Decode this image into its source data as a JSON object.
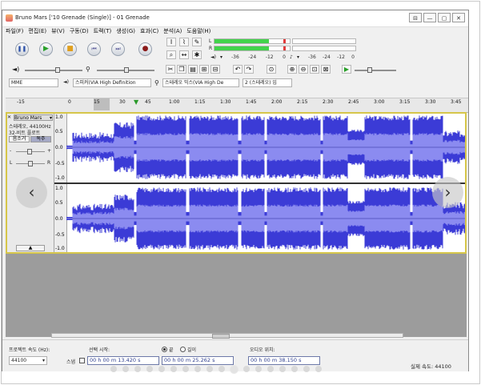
{
  "window": {
    "title": "Bruno Mars ['10 Grenade (Single)] - 01 Grenade",
    "buttons": [
      "⊟",
      "—",
      "▢",
      "✕"
    ]
  },
  "menu": [
    "파일(F)",
    "편집(E)",
    "뷰(V)",
    "구동(D)",
    "트랙(T)",
    "생성(G)",
    "효과(C)",
    "분석(A)",
    "도움말(H)"
  ],
  "transport": {
    "pause": "❚❚",
    "play": "▶",
    "stop": "■",
    "skip_start": "⏮",
    "skip_end": "⏭",
    "record": "●"
  },
  "meters": {
    "left_label": "L",
    "right_label": "R",
    "scale": [
      "-36",
      "-24",
      "-12",
      "0"
    ],
    "rec_scale": [
      "-36",
      "-24",
      "-12",
      "0"
    ],
    "left_level": 0.72,
    "right_level": 0.72,
    "colors": {
      "level": "#42d34b",
      "clip": "#e03c3c"
    }
  },
  "device": {
    "host": "MME",
    "output": "스피커(VIA High Definition",
    "input": "스테레오 믹스(VIA High De",
    "channels": "2 (스테레오) 입"
  },
  "timeline": {
    "ticks": [
      "-15",
      "0",
      "15",
      "30",
      "45",
      "1:00",
      "1:15",
      "1:30",
      "1:45",
      "2:00",
      "2:15",
      "2:30",
      "2:45",
      "3:00",
      "3:15",
      "3:30",
      "3:45"
    ]
  },
  "track": {
    "name": "Bruno Mars",
    "info_line1": "스테레오, 44100Hz",
    "info_line2": "32-비트 플로트",
    "mute": "음소거",
    "solo": "독주",
    "gain_minus": "-",
    "gain_plus": "+",
    "pan_left": "L",
    "pan_right": "R",
    "collapse": "▲",
    "vruler": [
      "1.0",
      "0.5",
      "0.0",
      "-0.5",
      "-1.0"
    ],
    "wave_color": "#3b3bd6",
    "wave_light": "#8b8bf0"
  },
  "selection_toolbar": {
    "rate_label": "프로젝트 속도 (Hz):",
    "rate_value": "44100",
    "snap_label": "스냅",
    "start_label": "선택 시작:",
    "end_label": "끝",
    "length_label": "길이",
    "audio_pos_label": "오디오 위치:",
    "start_value": "00 h 00 m 13.420 s",
    "end_value": "00 h 00 m 25.262 s",
    "audio_pos_value": "00 h 00 m 38.150 s"
  },
  "status": {
    "actual_rate": "실제 속도: 44100"
  },
  "carousel": {
    "prev": "‹",
    "next": "›",
    "dot_count": 18,
    "active_index": 10
  }
}
